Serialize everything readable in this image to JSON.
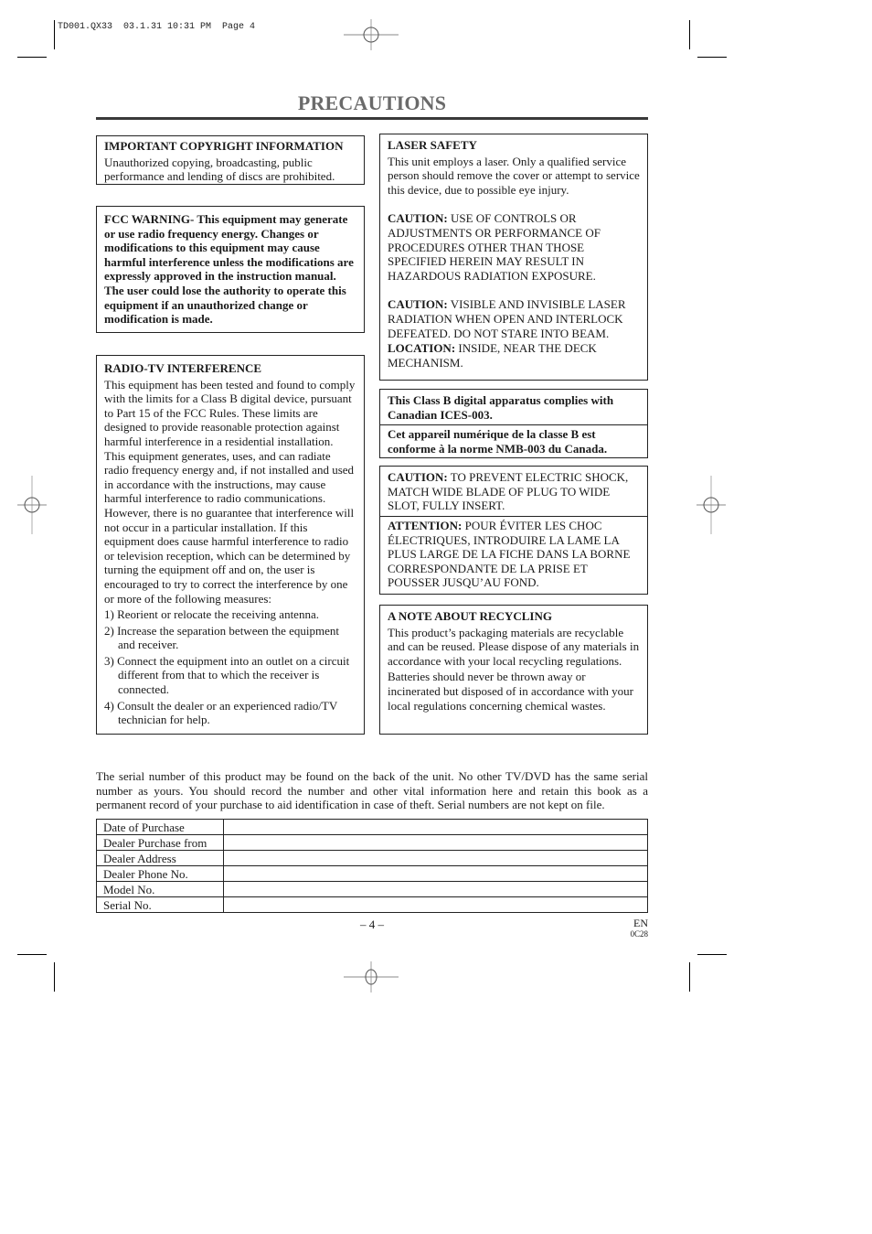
{
  "slug_line": "TD001.QX33  03.1.31 10:31 PM  Page 4",
  "page_title": "PRECAUTIONS",
  "copyright": {
    "heading": "IMPORTANT COPYRIGHT INFORMATION",
    "body": "Unauthorized copying, broadcasting, public performance and lending of discs are prohibited."
  },
  "fcc_warning": {
    "text": "FCC WARNING- This equipment may generate or use radio frequency energy. Changes or modifications to this equipment may cause harmful interference unless the modifications are expressly approved in the instruction manual. The user could lose the authority to operate this equipment if an unauthorized change or modification is made."
  },
  "radio_tv": {
    "heading": "RADIO-TV INTERFERENCE",
    "para1": "This equipment has been tested and found to comply with the limits for a Class B digital device, pursuant to Part 15 of the FCC Rules. These limits are designed to provide reasonable protection against harmful interference in a residential installation.",
    "para2": "This equipment generates, uses, and can radiate radio frequency energy and, if not installed and used in accordance with the instructions, may cause harmful interference to radio communications.",
    "para3": "However, there is no guarantee that interference will not occur in a particular installation. If this equipment does cause harmful interference to radio or television reception, which can be determined by turning the equipment off and on, the user is encouraged to try to correct the interference by one or more of the following measures:",
    "measures": [
      "1) Reorient or relocate the receiving antenna.",
      "2) Increase the separation between the equipment and receiver.",
      "3) Connect the equipment into an outlet on a circuit different from that to which the receiver is connected.",
      "4) Consult the dealer or an experienced radio/TV technician for help."
    ]
  },
  "laser_safety": {
    "heading": "LASER SAFETY",
    "body": "This unit employs a laser. Only a qualified service person should remove the cover or attempt to service this device, due to possible eye injury.",
    "caution1_label": "CAUTION:",
    "caution1_text": " USE OF CONTROLS OR ADJUSTMENTS OR PERFORMANCE OF PROCEDURES OTHER THAN THOSE SPECIFIED HEREIN MAY RESULT IN HAZARDOUS RADIATION EXPOSURE.",
    "caution2_label": "CAUTION:",
    "caution2_text": " VISIBLE AND INVISIBLE LASER RADIATION WHEN OPEN AND INTERLOCK DEFEATED. DO NOT STARE INTO BEAM.",
    "location_label": "LOCATION:",
    "location_text": " INSIDE, NEAR THE DECK MECHANISM."
  },
  "canada": {
    "english": "This Class B digital apparatus complies with Canadian ICES-003.",
    "french": "Cet appareil numérique de la classe B est conforme à la norme NMB-003 du Canada."
  },
  "plug": {
    "caution_label": "CAUTION:",
    "caution_text": " TO PREVENT ELECTRIC SHOCK, MATCH WIDE BLADE OF PLUG TO WIDE SLOT, FULLY INSERT.",
    "attention_label": "ATTENTION:",
    "attention_text": " POUR ÉVITER LES CHOC ÉLECTRIQUES, INTRODUIRE LA LAME LA PLUS LARGE DE LA FICHE DANS LA BORNE CORRESPONDANTE DE LA PRISE ET POUSSER JUSQU’AU FOND."
  },
  "recycling": {
    "heading": "A NOTE ABOUT RECYCLING",
    "para1": "This product’s packaging materials are recyclable and can be reused. Please dispose of any materials in accordance with your local recycling regulations.",
    "para2": "Batteries should never be thrown away or incinerated but disposed of in accordance with your local regulations concerning chemical wastes."
  },
  "serial_note": "The serial number of this product may be found on the back of the unit. No other TV/DVD has the same serial number as yours. You should record the number and other vital information here and retain this book as a permanent record of your purchase to aid identification in case of theft. Serial numbers are not kept on file.",
  "record_table": {
    "rows": [
      {
        "label": "Date of Purchase",
        "value": ""
      },
      {
        "label": "Dealer Purchase from",
        "value": ""
      },
      {
        "label": "Dealer Address",
        "value": ""
      },
      {
        "label": "Dealer Phone No.",
        "value": ""
      },
      {
        "label": "Model No.",
        "value": ""
      },
      {
        "label": "Serial No.",
        "value": ""
      }
    ]
  },
  "footer": {
    "page_number": "– 4 –",
    "language": "EN",
    "code": "0C28"
  }
}
